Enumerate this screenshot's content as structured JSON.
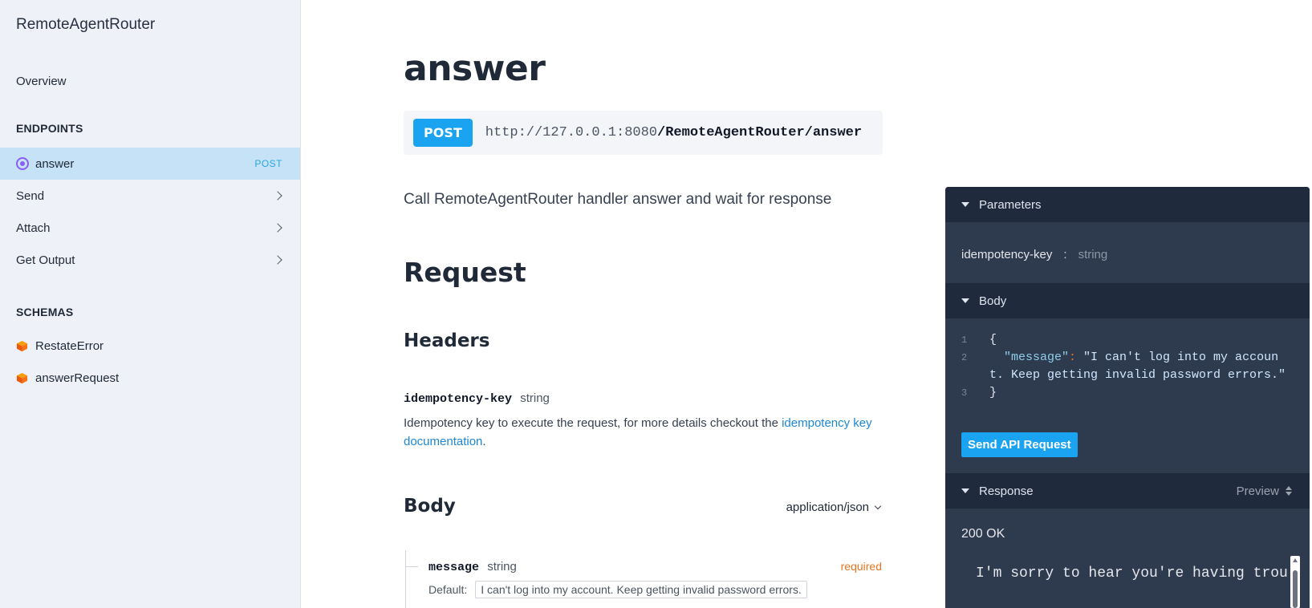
{
  "sidebar": {
    "brand": "RemoteAgentRouter",
    "overview": "Overview",
    "endpoints_title": "ENDPOINTS",
    "endpoints": [
      {
        "label": "answer",
        "badge": "POST"
      },
      {
        "label": "Send"
      },
      {
        "label": "Attach"
      },
      {
        "label": "Get Output"
      }
    ],
    "schemas_title": "SCHEMAS",
    "schemas": [
      {
        "label": "RestateError"
      },
      {
        "label": "answerRequest"
      }
    ]
  },
  "main": {
    "title": "answer",
    "method": "POST",
    "url_base": "http://127.0.0.1:8080",
    "url_path": "/RemoteAgentRouter/answer",
    "description": "Call RemoteAgentRouter handler answer and wait for response",
    "request_heading": "Request",
    "headers_heading": "Headers",
    "header_param": {
      "name": "idempotency-key",
      "type": "string",
      "desc_prefix": "Idempotency key to execute the request, for more details checkout the ",
      "link_text": "idempotency key documentation",
      "desc_suffix": "."
    },
    "body_heading": "Body",
    "content_type": "application/json",
    "body_field": {
      "name": "message",
      "type": "string",
      "required": "required",
      "default_label": "Default:",
      "default_value": "I can't log into my account. Keep getting invalid password errors."
    }
  },
  "panel": {
    "parameters_label": "Parameters",
    "param_name": "idempotency-key",
    "param_sep": ":",
    "param_type": "string",
    "body_label": "Body",
    "code": {
      "line1_num": "1",
      "line1": "{",
      "line2_num": "2",
      "line2_key": "\"message\"",
      "line2_colon": ": ",
      "line2_val_a": "\"I can't log into my accoun",
      "line2_val_b": "t. Keep getting invalid password errors.\"",
      "line3_num": "3",
      "line3": "}"
    },
    "send_button": "Send API Request",
    "response_label": "Response",
    "preview_label": "Preview",
    "status": "200 OK",
    "response_text": "I'm sorry to hear you're having trou"
  },
  "colors": {
    "accent": "#1aa3f0",
    "sidebar_bg": "#eef2f8",
    "sidebar_active": "#c5e2f7",
    "panel_bg": "#2e3a4e",
    "panel_header": "#1f2a3c",
    "required": "#e8741f",
    "link": "#1d87d6"
  },
  "icons": {
    "endpoint_active": "target-icon",
    "schema": "cube-icon",
    "expand": "chevron-right-icon",
    "collapse": "caret-down-icon"
  }
}
